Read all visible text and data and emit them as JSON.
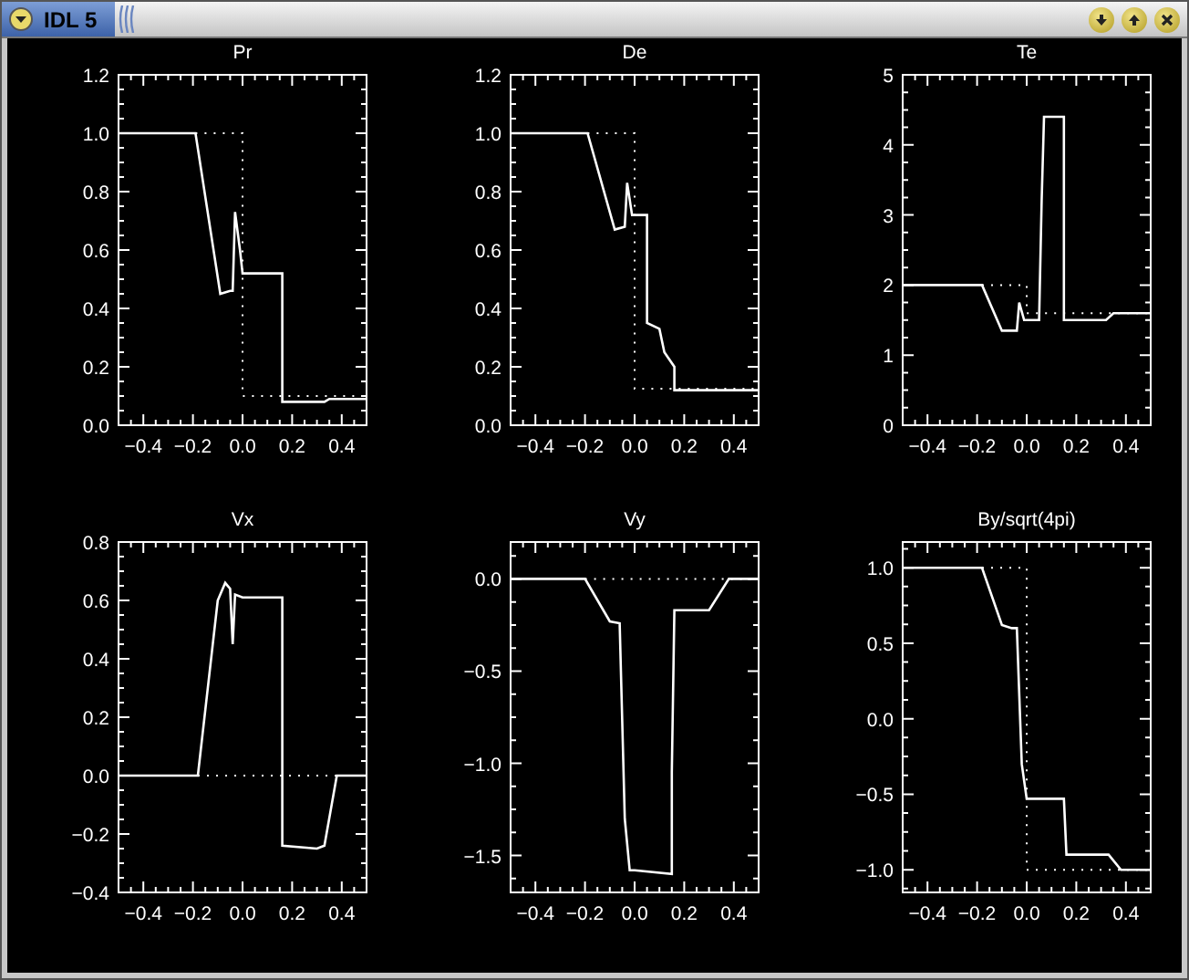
{
  "window": {
    "title": "IDL 5"
  },
  "plots": [
    {
      "chart_data": {
        "type": "line",
        "title": "Pr",
        "x": [
          -0.5,
          -0.19,
          -0.09,
          -0.05,
          -0.04,
          -0.03,
          -0.01,
          0,
          0,
          0.16,
          0.16,
          0.33,
          0.35,
          0.5
        ],
        "xlim": [
          -0.5,
          0.5
        ],
        "ylim": [
          0,
          1.2
        ],
        "xticks": [
          {
            "value": -0.4,
            "label": "−0.4"
          },
          {
            "value": -0.2,
            "label": "−0.2"
          },
          {
            "value": 0,
            "label": "0.0"
          },
          {
            "value": 0.2,
            "label": "0.2"
          },
          {
            "value": 0.4,
            "label": "0.4"
          }
        ],
        "yticks": [
          {
            "value": 0,
            "label": "0.0"
          },
          {
            "value": 0.2,
            "label": "0.2"
          },
          {
            "value": 0.4,
            "label": "0.4"
          },
          {
            "value": 0.6,
            "label": "0.6"
          },
          {
            "value": 0.8,
            "label": "0.8"
          },
          {
            "value": 1,
            "label": "1.0"
          },
          {
            "value": 1.2,
            "label": "1.2"
          }
        ],
        "series": [
          {
            "line_style": "solid",
            "values": [
              1,
              1,
              0.45,
              0.46,
              0.46,
              0.73,
              0.6,
              0.52,
              0.52,
              0.52,
              0.08,
              0.08,
              0.09,
              0.09
            ]
          },
          {
            "line_style": "dotted",
            "values": [
              null,
              1,
              1,
              1,
              1,
              1,
              1,
              1,
              0.1,
              0.1,
              0.1,
              0.1,
              0.1,
              0.1
            ]
          }
        ]
      }
    },
    {
      "chart_data": {
        "type": "line",
        "title": "De",
        "x": [
          -0.5,
          -0.19,
          -0.08,
          -0.04,
          -0.03,
          -0.01,
          0,
          0,
          0.05,
          0.05,
          0.1,
          0.12,
          0.16,
          0.16,
          0.5
        ],
        "xlim": [
          -0.5,
          0.5
        ],
        "ylim": [
          0,
          1.2
        ],
        "xticks": [
          {
            "value": -0.4,
            "label": "−0.4"
          },
          {
            "value": -0.2,
            "label": "−0.2"
          },
          {
            "value": 0,
            "label": "0.0"
          },
          {
            "value": 0.2,
            "label": "0.2"
          },
          {
            "value": 0.4,
            "label": "0.4"
          }
        ],
        "yticks": [
          {
            "value": 0,
            "label": "0.0"
          },
          {
            "value": 0.2,
            "label": "0.2"
          },
          {
            "value": 0.4,
            "label": "0.4"
          },
          {
            "value": 0.6,
            "label": "0.6"
          },
          {
            "value": 0.8,
            "label": "0.8"
          },
          {
            "value": 1,
            "label": "1.0"
          },
          {
            "value": 1.2,
            "label": "1.2"
          }
        ],
        "series": [
          {
            "line_style": "solid",
            "values": [
              1,
              1,
              0.67,
              0.68,
              0.83,
              0.72,
              0.72,
              0.72,
              0.72,
              0.35,
              0.33,
              0.25,
              0.2,
              0.12,
              0.12
            ]
          },
          {
            "line_style": "dotted",
            "values": [
              null,
              1,
              1,
              1,
              1,
              1,
              1,
              0.125,
              0.125,
              0.125,
              0.125,
              0.125,
              0.125,
              0.125,
              0.125
            ]
          }
        ]
      }
    },
    {
      "chart_data": {
        "type": "line",
        "title": "Te",
        "x": [
          -0.5,
          -0.18,
          -0.1,
          -0.06,
          -0.04,
          -0.03,
          -0.01,
          0,
          0,
          0.05,
          0.06,
          0.07,
          0.15,
          0.15,
          0.32,
          0.35,
          0.5
        ],
        "xlim": [
          -0.5,
          0.5
        ],
        "ylim": [
          0,
          5
        ],
        "xticks": [
          {
            "value": -0.4,
            "label": "−0.4"
          },
          {
            "value": -0.2,
            "label": "−0.2"
          },
          {
            "value": 0,
            "label": "0.0"
          },
          {
            "value": 0.2,
            "label": "0.2"
          },
          {
            "value": 0.4,
            "label": "0.4"
          }
        ],
        "yticks": [
          0,
          1,
          2,
          3,
          4,
          5
        ],
        "series": [
          {
            "line_style": "solid",
            "values": [
              2,
              2,
              1.35,
              1.35,
              1.35,
              1.75,
              1.5,
              1.5,
              1.5,
              1.5,
              3.2,
              4.4,
              4.4,
              1.5,
              1.5,
              1.6,
              1.6
            ]
          },
          {
            "line_style": "dotted",
            "values": [
              null,
              2,
              2,
              2,
              2,
              2,
              2,
              2,
              1.6,
              1.6,
              1.6,
              1.6,
              1.6,
              1.6,
              1.6,
              1.6,
              1.6
            ]
          }
        ]
      }
    },
    {
      "chart_data": {
        "type": "line",
        "title": "Vx",
        "x": [
          -0.5,
          -0.18,
          -0.1,
          -0.07,
          -0.05,
          -0.04,
          -0.03,
          0,
          0,
          0.15,
          0.16,
          0.16,
          0.3,
          0.33,
          0.38,
          0.5
        ],
        "xlim": [
          -0.5,
          0.5
        ],
        "ylim": [
          -0.4,
          0.8
        ],
        "xticks": [
          {
            "value": -0.4,
            "label": "−0.4"
          },
          {
            "value": -0.2,
            "label": "−0.2"
          },
          {
            "value": 0,
            "label": "0.0"
          },
          {
            "value": 0.2,
            "label": "0.2"
          },
          {
            "value": 0.4,
            "label": "0.4"
          }
        ],
        "yticks": [
          {
            "value": -0.4,
            "label": "−0.4"
          },
          {
            "value": -0.2,
            "label": "−0.2"
          },
          {
            "value": 0,
            "label": "0.0"
          },
          {
            "value": 0.2,
            "label": "0.2"
          },
          {
            "value": 0.4,
            "label": "0.4"
          },
          {
            "value": 0.6,
            "label": "0.6"
          },
          {
            "value": 0.8,
            "label": "0.8"
          }
        ],
        "series": [
          {
            "line_style": "solid",
            "values": [
              0,
              0,
              0.6,
              0.66,
              0.64,
              0.45,
              0.62,
              0.61,
              0.61,
              0.61,
              0.61,
              -0.24,
              -0.25,
              -0.24,
              0,
              0
            ]
          },
          {
            "line_style": "dotted",
            "values": [
              null,
              0,
              0,
              0,
              0,
              0,
              0,
              0,
              0,
              0,
              0,
              0,
              0,
              0,
              0,
              0
            ]
          }
        ]
      }
    },
    {
      "chart_data": {
        "type": "line",
        "title": "Vy",
        "x": [
          -0.5,
          -0.2,
          -0.1,
          -0.06,
          -0.04,
          -0.02,
          0,
          0,
          0.15,
          0.15,
          0.16,
          0.3,
          0.38,
          0.5
        ],
        "xlim": [
          -0.5,
          0.5
        ],
        "ylim": [
          -1.7,
          0.2
        ],
        "xticks": [
          {
            "value": -0.4,
            "label": "−0.4"
          },
          {
            "value": -0.2,
            "label": "−0.2"
          },
          {
            "value": 0,
            "label": "0.0"
          },
          {
            "value": 0.2,
            "label": "0.2"
          },
          {
            "value": 0.4,
            "label": "0.4"
          }
        ],
        "yticks": [
          {
            "value": -1.5,
            "label": "−1.5"
          },
          {
            "value": -1,
            "label": "−1.0"
          },
          {
            "value": -0.5,
            "label": "−0.5"
          },
          {
            "value": 0,
            "label": "0.0"
          }
        ],
        "series": [
          {
            "line_style": "solid",
            "values": [
              0,
              0,
              -0.23,
              -0.24,
              -1.3,
              -1.58,
              -1.58,
              -1.58,
              -1.6,
              -1.05,
              -0.17,
              -0.17,
              0,
              0
            ]
          },
          {
            "line_style": "dotted",
            "values": [
              null,
              0,
              0,
              0,
              0,
              0,
              0,
              0,
              0,
              0,
              0,
              0,
              0,
              0
            ]
          }
        ]
      }
    },
    {
      "chart_data": {
        "type": "line",
        "title": "By/sqrt(4pi)",
        "x": [
          -0.5,
          -0.18,
          -0.1,
          -0.06,
          -0.04,
          -0.02,
          0,
          0,
          0.05,
          0.06,
          0.15,
          0.16,
          0.3,
          0.33,
          0.38,
          0.5
        ],
        "xlim": [
          -0.5,
          0.5
        ],
        "ylim": [
          -1.15,
          1.17
        ],
        "xticks": [
          {
            "value": -0.4,
            "label": "−0.4"
          },
          {
            "value": -0.2,
            "label": "−0.2"
          },
          {
            "value": 0,
            "label": "0.0"
          },
          {
            "value": 0.2,
            "label": "0.2"
          },
          {
            "value": 0.4,
            "label": "0.4"
          }
        ],
        "yticks": [
          {
            "value": -1,
            "label": "−1.0"
          },
          {
            "value": -0.5,
            "label": "−0.5"
          },
          {
            "value": 0,
            "label": "0.0"
          },
          {
            "value": 0.5,
            "label": "0.5"
          },
          {
            "value": 1,
            "label": "1.0"
          }
        ],
        "series": [
          {
            "line_style": "solid",
            "values": [
              1,
              1,
              0.62,
              0.6,
              0.6,
              -0.3,
              -0.53,
              -0.53,
              -0.53,
              -0.53,
              -0.53,
              -0.9,
              -0.9,
              -0.9,
              -1,
              -1
            ]
          },
          {
            "line_style": "dotted",
            "values": [
              null,
              1,
              1,
              1,
              1,
              1,
              1,
              -1,
              -1,
              -1,
              -1,
              -1,
              -1,
              -1,
              -1,
              -1
            ]
          }
        ]
      }
    }
  ]
}
